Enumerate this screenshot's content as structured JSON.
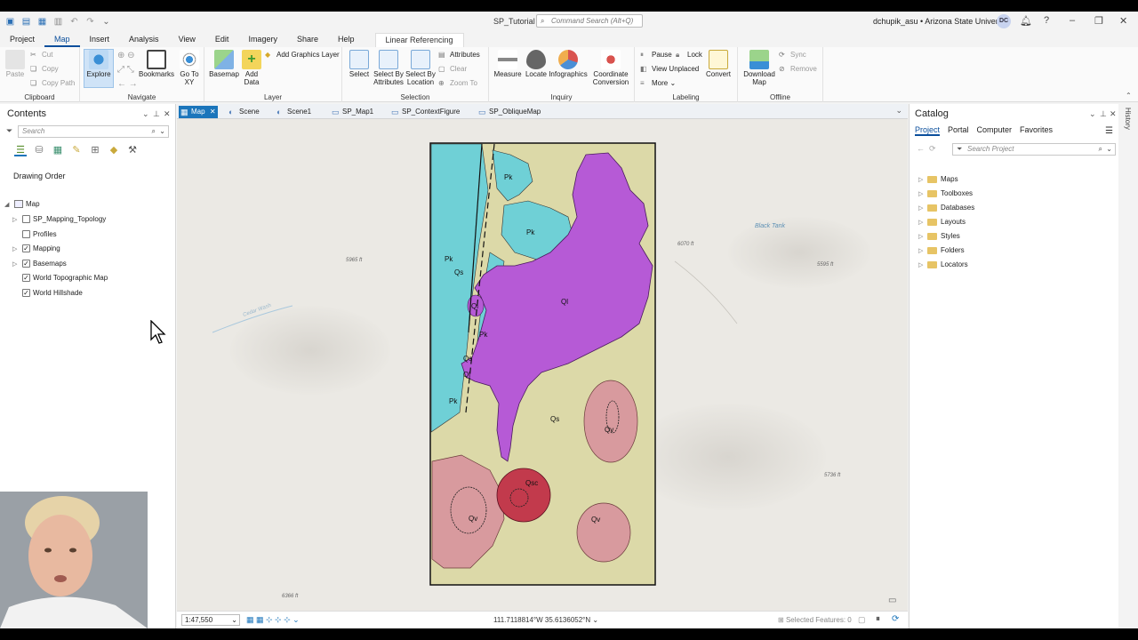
{
  "window": {
    "title": "SP_Tutorial",
    "command_search_placeholder": "Command Search (Alt+Q)",
    "user": "dchupik_asu • Arizona State University",
    "avatar_initials": "DC"
  },
  "ribbon_tabs": [
    "Project",
    "Map",
    "Insert",
    "Analysis",
    "View",
    "Edit",
    "Imagery",
    "Share",
    "Help",
    "Linear Referencing"
  ],
  "ribbon": {
    "clipboard": {
      "label": "Clipboard",
      "paste": "Paste",
      "cut": "Cut",
      "copy": "Copy",
      "copy_path": "Copy Path"
    },
    "navigate": {
      "label": "Navigate",
      "explore": "Explore",
      "bookmarks": "Bookmarks",
      "go_to_xy": "Go To XY"
    },
    "layer": {
      "label": "Layer",
      "basemap": "Basemap",
      "add_data": "Add Data",
      "add_graphics_layer": "Add Graphics Layer"
    },
    "selection": {
      "label": "Selection",
      "select": "Select",
      "select_by_attributes": "Select By Attributes",
      "select_by_location": "Select By Location",
      "attributes": "Attributes",
      "clear": "Clear",
      "zoom_to": "Zoom To"
    },
    "inquiry": {
      "label": "Inquiry",
      "measure": "Measure",
      "locate": "Locate",
      "infographics": "Infographics",
      "coordinate_conversion": "Coordinate Conversion"
    },
    "labeling": {
      "label": "Labeling",
      "pause": "Pause",
      "lock": "Lock",
      "view_unplaced": "View Unplaced",
      "more": "More",
      "convert": "Convert"
    },
    "offline": {
      "label": "Offline",
      "download_map": "Download Map",
      "sync": "Sync",
      "remove": "Remove"
    }
  },
  "contents": {
    "title": "Contents",
    "search_placeholder": "Search",
    "drawing_order": "Drawing Order",
    "map_name": "Map",
    "layers": [
      {
        "name": "SP_Mapping_Topology",
        "checked": false,
        "expandable": true
      },
      {
        "name": "Profiles",
        "checked": false,
        "expandable": false
      },
      {
        "name": "Mapping",
        "checked": true,
        "expandable": true
      },
      {
        "name": "Basemaps",
        "checked": true,
        "expandable": true
      },
      {
        "name": "World Topographic Map",
        "checked": true,
        "expandable": false
      },
      {
        "name": "World Hillshade",
        "checked": true,
        "expandable": false
      }
    ]
  },
  "map_tabs": [
    "Map",
    "Scene",
    "Scene1",
    "SP_Map1",
    "SP_ContextFigure",
    "SP_ObliqueMap"
  ],
  "map": {
    "labels": {
      "pk1": "Pk",
      "pk2": "Pk",
      "pk3": "Pk",
      "pk4": "Pk",
      "pk5": "Pk",
      "ql1": "Ql",
      "ql2": "Ql",
      "ql3": "Ql",
      "qs1": "Qs",
      "qs2": "Qs",
      "qs3": "Qs",
      "qv1": "Qv",
      "qv2": "Qv",
      "qv3": "Qv",
      "qsc": "Qsc"
    },
    "basemap_labels": {
      "elev1": "5965 ft",
      "elev2": "6070 ft",
      "elev3": "5595 ft",
      "elev4": "5736 ft",
      "elev5": "6366 ft",
      "wash": "Cedar Wash",
      "tank": "Black Tank"
    }
  },
  "status": {
    "scale": "1:47,550",
    "coordinates": "111.7118814°W 35.6136052°N",
    "selected_features": "Selected Features: 0"
  },
  "catalog": {
    "title": "Catalog",
    "tabs": [
      "Project",
      "Portal",
      "Computer",
      "Favorites"
    ],
    "search_placeholder": "Search Project",
    "items": [
      "Maps",
      "Toolboxes",
      "Databases",
      "Layouts",
      "Styles",
      "Folders",
      "Locators"
    ]
  },
  "history_label": "History",
  "colors": {
    "accent": "#1b75bb",
    "pk": "#6fd0d6",
    "ql": "#b65ad6",
    "qs": "#dcd9a8",
    "qv": "#d89a9e",
    "qsc": "#c23a4c"
  }
}
